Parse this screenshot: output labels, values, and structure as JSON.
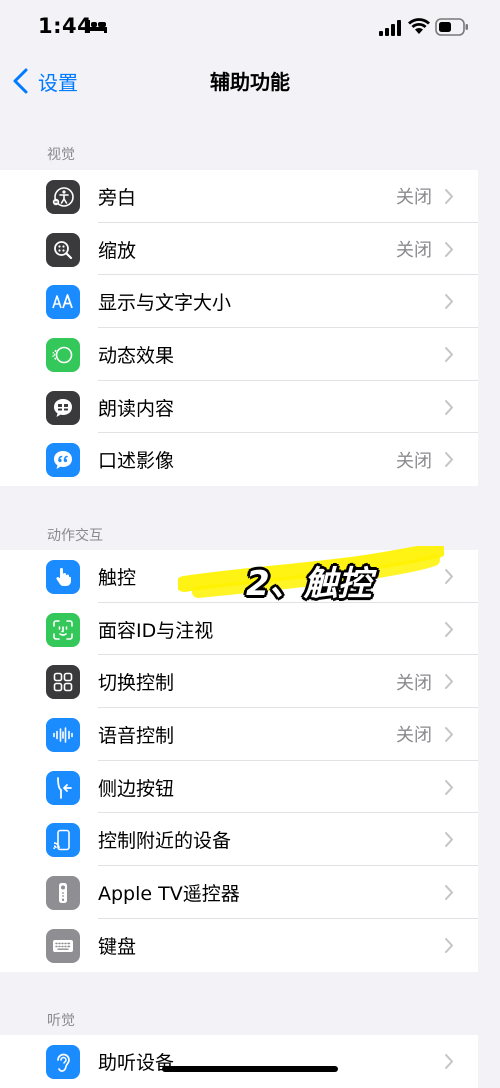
{
  "status_bar": {
    "time": "1:44"
  },
  "nav": {
    "back_label": "设置",
    "title": "辅助功能"
  },
  "sections": [
    {
      "header": "视觉",
      "rows": [
        {
          "label": "旁白",
          "value": "关闭",
          "icon": "voiceover-icon",
          "color": "#3a3a3c"
        },
        {
          "label": "缩放",
          "value": "关闭",
          "icon": "zoom-icon",
          "color": "#3a3a3c"
        },
        {
          "label": "显示与文字大小",
          "value": "",
          "icon": "text-size-icon",
          "color": "#1a8cff"
        },
        {
          "label": "动态效果",
          "value": "",
          "icon": "motion-icon",
          "color": "#34c759"
        },
        {
          "label": "朗读内容",
          "value": "",
          "icon": "spoken-content-icon",
          "color": "#3a3a3c"
        },
        {
          "label": "口述影像",
          "value": "关闭",
          "icon": "audio-description-icon",
          "color": "#1a8cff"
        }
      ]
    },
    {
      "header": "动作交互",
      "rows": [
        {
          "label": "触控",
          "value": "",
          "icon": "touch-icon",
          "color": "#1a8cff"
        },
        {
          "label": "面容ID与注视",
          "value": "",
          "icon": "face-id-icon",
          "color": "#34c759"
        },
        {
          "label": "切换控制",
          "value": "关闭",
          "icon": "switch-control-icon",
          "color": "#3a3a3c"
        },
        {
          "label": "语音控制",
          "value": "关闭",
          "icon": "voice-control-icon",
          "color": "#1a8cff"
        },
        {
          "label": "侧边按钮",
          "value": "",
          "icon": "side-button-icon",
          "color": "#1a8cff"
        },
        {
          "label": "控制附近的设备",
          "value": "",
          "icon": "nearby-devices-icon",
          "color": "#1a8cff"
        },
        {
          "label": "Apple TV遥控器",
          "value": "",
          "icon": "apple-tv-remote-icon",
          "color": "#8e8e93"
        },
        {
          "label": "键盘",
          "value": "",
          "icon": "keyboard-icon",
          "color": "#8e8e93"
        }
      ]
    },
    {
      "header": "听觉",
      "rows": [
        {
          "label": "助听设备",
          "value": "",
          "icon": "hearing-devices-icon",
          "color": "#1a8cff"
        }
      ]
    }
  ],
  "overlay": {
    "text": "2、触控",
    "highlight_color": "#fff200"
  },
  "colors": {
    "accent": "#007aff",
    "background": "#f2f2f7",
    "secondary_text": "#8a8a8e"
  }
}
